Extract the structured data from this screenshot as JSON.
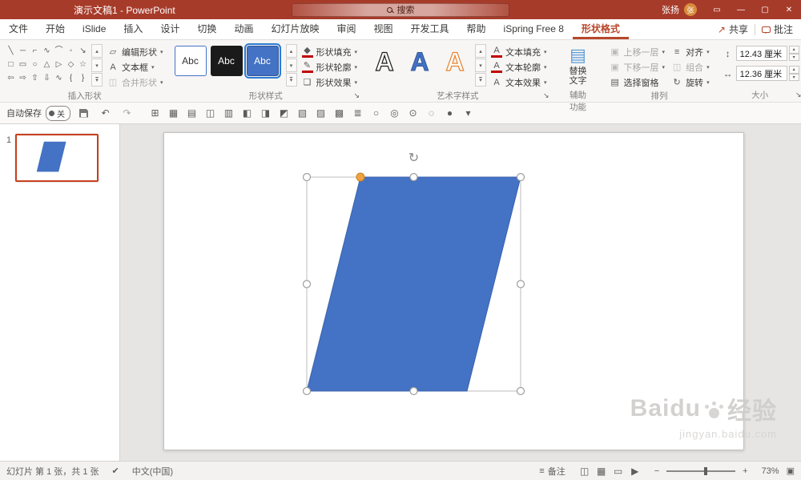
{
  "colors": {
    "titlebar": "#A73B2A",
    "accent_red": "#B7472A",
    "shape_fill": "#4472C4",
    "shape_stroke": "#3A62AC",
    "adjust_handle": "#F0A23C",
    "thumb_selected_border": "#C8401E"
  },
  "icons": {
    "display_options": "▭",
    "minimize": "—",
    "maximize": "▢",
    "close": "✕",
    "share": "↗",
    "caret": "▾",
    "undo": "↶",
    "redo": "↷",
    "height": "↕",
    "width": "↔",
    "spin_up": "▴",
    "spin_down": "▾",
    "dialog_launcher": "↘",
    "gallery_up": "▴",
    "gallery_down": "▾",
    "gallery_more": "▾",
    "notes": "≡",
    "zoom_out": "−",
    "zoom_in": "+",
    "fit": "▣",
    "spellcheck": "✔",
    "rotation_handle": "↻",
    "accessibility_button": "▤"
  },
  "titlebar": {
    "title": "演示文稿1 - PowerPoint",
    "search_placeholder": "搜索",
    "user_name": "张扬",
    "avatar_initial": "张"
  },
  "ribbon": {
    "tabs": [
      {
        "key": "file",
        "label": "文件"
      },
      {
        "key": "home",
        "label": "开始"
      },
      {
        "key": "islide",
        "label": "iSlide"
      },
      {
        "key": "insert",
        "label": "插入"
      },
      {
        "key": "design",
        "label": "设计"
      },
      {
        "key": "transitions",
        "label": "切换"
      },
      {
        "key": "animations",
        "label": "动画"
      },
      {
        "key": "slide-show",
        "label": "幻灯片放映"
      },
      {
        "key": "review",
        "label": "审阅"
      },
      {
        "key": "view",
        "label": "视图"
      },
      {
        "key": "developer",
        "label": "开发工具"
      },
      {
        "key": "help",
        "label": "帮助"
      },
      {
        "key": "ispring-free-8",
        "label": "iSpring Free 8"
      },
      {
        "key": "shape-format",
        "label": "形状格式",
        "active": true
      }
    ],
    "share_label": "共享",
    "comments_label": "批注"
  },
  "insert_shapes": {
    "label": "插入形状",
    "gallery_rows": [
      [
        "╲",
        "─",
        "⌐",
        "∿",
        "⌒",
        "◦",
        "↘"
      ],
      [
        "□",
        "▭",
        "○",
        "△",
        "▷",
        "◇",
        "☆"
      ],
      [
        "⇦",
        "⇨",
        "⇧",
        "⇩",
        "∿",
        "{",
        "}"
      ]
    ],
    "buttons": [
      {
        "name": "edit-shape-button",
        "icon_name": "edit-shape-icon",
        "icon": "▱",
        "label": "编辑形状",
        "caret": true,
        "disabled": false
      },
      {
        "name": "text-box-button",
        "icon_name": "text-box-icon",
        "icon": "A",
        "label": "文本框",
        "caret": true,
        "disabled": false
      },
      {
        "name": "merge-shapes-button",
        "icon_name": "merge-shapes-icon",
        "icon": "◫",
        "label": "合并形状",
        "caret": true,
        "disabled": true
      }
    ]
  },
  "shape_styles": {
    "label": "形状样式",
    "tiles": [
      "Abc",
      "Abc",
      "Abc"
    ],
    "buttons": [
      {
        "name": "shape-fill-button",
        "icon_name": "shape-fill-icon",
        "icon": "◆",
        "bar": "#C00000",
        "label": "形状填充",
        "caret": true,
        "disabled": false
      },
      {
        "name": "shape-outline-button",
        "icon_name": "shape-outline-icon",
        "icon": "✎",
        "bar": "#C00000",
        "label": "形状轮廓",
        "caret": true,
        "disabled": false
      },
      {
        "name": "shape-effects-button",
        "icon_name": "shape-effects-icon",
        "icon": "❏",
        "label": "形状效果",
        "caret": true,
        "disabled": false
      }
    ]
  },
  "wordart": {
    "label": "艺术字样式",
    "letters": [
      "A",
      "A",
      "A"
    ],
    "buttons": [
      {
        "name": "text-fill-button",
        "icon_name": "text-fill-icon",
        "icon": "A",
        "bar": "#C00000",
        "label": "文本填充",
        "caret": true,
        "disabled": false
      },
      {
        "name": "text-outline-button",
        "icon_name": "text-outline-icon",
        "icon": "A",
        "bar": "#C00000",
        "label": "文本轮廓",
        "caret": true,
        "disabled": false
      },
      {
        "name": "text-effects-button",
        "icon_name": "text-effects-icon",
        "icon": "A",
        "label": "文本效果",
        "caret": true,
        "disabled": false
      }
    ]
  },
  "accessibility": {
    "label": "辅助功能",
    "button_line1": "替换",
    "button_line2": "文字"
  },
  "arrange": {
    "label": "排列",
    "buttons_col1": [
      {
        "name": "bring-forward-button",
        "icon_name": "bring-forward-icon",
        "icon": "▣",
        "label": "上移一层",
        "caret": true,
        "disabled": true
      },
      {
        "name": "send-backward-button",
        "icon_name": "send-backward-icon",
        "icon": "▣",
        "label": "下移一层",
        "caret": true,
        "disabled": true
      },
      {
        "name": "selection-pane-button",
        "icon_name": "selection-pane-icon",
        "icon": "▤",
        "label": "选择窗格",
        "caret": false,
        "disabled": false
      }
    ],
    "buttons_col2": [
      {
        "name": "align-button",
        "icon_name": "align-icon",
        "icon": "≡",
        "label": "对齐",
        "caret": true,
        "disabled": false
      },
      {
        "name": "group-button",
        "icon_name": "group-icon",
        "icon": "◫",
        "label": "组合",
        "caret": true,
        "disabled": true
      },
      {
        "name": "rotate-button",
        "icon_name": "rotate-icon",
        "icon": "↻",
        "label": "旋转",
        "caret": true,
        "disabled": false
      }
    ]
  },
  "size": {
    "label": "大小",
    "height_value": "12.43 厘米",
    "width_value": "12.36 厘米"
  },
  "qat": {
    "autosave_label": "自动保存",
    "autosave_state": "关",
    "icons": [
      {
        "name": "grid-icon",
        "glyph": "⊞"
      },
      {
        "name": "table-icon",
        "glyph": "▦"
      },
      {
        "name": "align-left-icon",
        "glyph": "▤"
      },
      {
        "name": "align-center-icon",
        "glyph": "◫"
      },
      {
        "name": "align-right-icon",
        "glyph": "▥"
      },
      {
        "name": "align-top-icon",
        "glyph": "◧"
      },
      {
        "name": "align-middle-icon",
        "glyph": "◨"
      },
      {
        "name": "align-bottom-icon",
        "glyph": "◩"
      },
      {
        "name": "distribute-horizontal-icon",
        "glyph": "▧"
      },
      {
        "name": "distribute-vertical-icon",
        "glyph": "▨"
      },
      {
        "name": "snap-grid-icon",
        "glyph": "▩"
      },
      {
        "name": "align-objects-icon",
        "glyph": "≣"
      },
      {
        "name": "oval-style-1-icon",
        "glyph": "○"
      },
      {
        "name": "oval-style-2-icon",
        "glyph": "◎"
      },
      {
        "name": "oval-style-3-icon",
        "glyph": "⊙"
      },
      {
        "name": "oval-style-4-icon",
        "glyph": "◌"
      },
      {
        "name": "oval-style-5-icon",
        "glyph": "●"
      },
      {
        "name": "more-commands-icon",
        "glyph": "▾"
      }
    ]
  },
  "slides_panel": {
    "slide_number": "1"
  },
  "statusbar": {
    "slide_counter": "幻灯片 第 1 张，共 1 张",
    "language": "中文(中国)",
    "notes_label": "备注",
    "zoom_percent": "73%",
    "view_icons": [
      {
        "name": "normal-view-icon",
        "glyph": "◫"
      },
      {
        "name": "slide-sorter-icon",
        "glyph": "▦"
      },
      {
        "name": "reading-view-icon",
        "glyph": "▭"
      },
      {
        "name": "slideshow-icon",
        "glyph": "▶"
      }
    ]
  },
  "watermark": {
    "brand": "Baidu",
    "suffix": "经验",
    "url": "jingyan.baidu.com"
  }
}
